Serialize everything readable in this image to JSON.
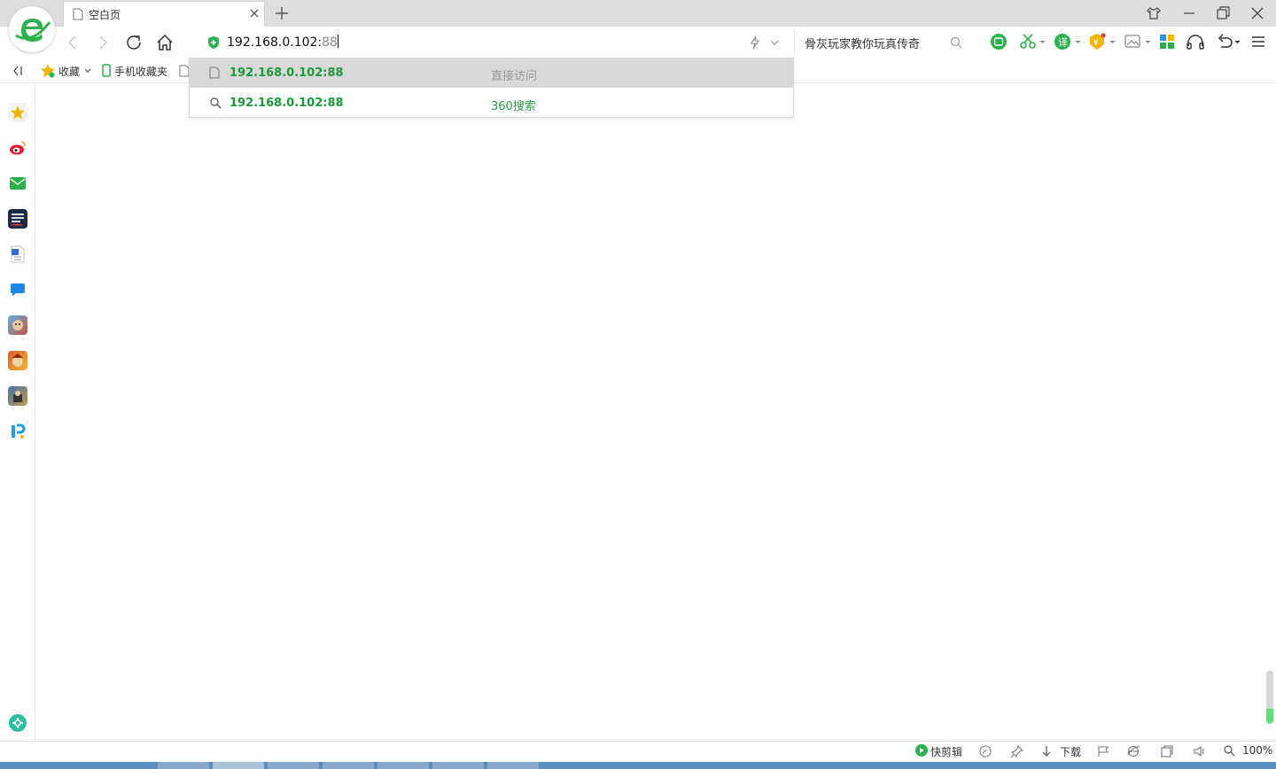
{
  "tab": {
    "title": "空白页"
  },
  "address": {
    "host": "192.168.0.102:",
    "port": "88"
  },
  "search": {
    "text": "骨灰玩家教你玩真传奇"
  },
  "bookmarks": {
    "favorites": "收藏",
    "mobile": "手机收藏夹"
  },
  "dropdown": {
    "items": [
      {
        "url": "192.168.0.102:88",
        "hint": "直接访问"
      },
      {
        "url": "192.168.0.102:88",
        "hint": "360搜索"
      }
    ]
  },
  "sidebar": {
    "items": [
      "star-icon",
      "weibo-icon",
      "mail-icon",
      "news-icon",
      "word-icon",
      "chat-icon",
      "game-icon",
      "game-icon",
      "game-icon",
      "pi-icon",
      "add-icon"
    ]
  },
  "statusbar": {
    "clip": "快剪辑",
    "download": "下载",
    "zoom": "100%"
  },
  "colors": {
    "accent": "#1a9a3a",
    "brand": "#2bb24c"
  }
}
